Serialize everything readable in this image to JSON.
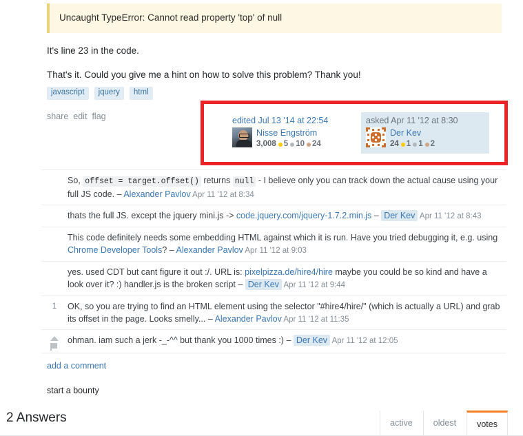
{
  "post": {
    "error_quote": "Uncaught TypeError: Cannot read property 'top' of null",
    "paragraph_1": "It's line 23 in the code.",
    "paragraph_2": "That's it. Could you give me a hint on how to solve this problem? Thank you!"
  },
  "tags": [
    "javascript",
    "jquery",
    "html"
  ],
  "post_menu": [
    "share",
    "edit",
    "flag"
  ],
  "user_cards": [
    {
      "action": "edited Jul 13 '14 at 22:54",
      "name": "Nisse Engström",
      "reputation": "3,008",
      "gold": "5",
      "silver": "10",
      "bronze": "24",
      "avatar_kind": "photo",
      "owner": false
    },
    {
      "action": "asked Apr 11 '12 at 8:30",
      "name": "Der Kev",
      "reputation": "24",
      "gold": "1",
      "silver": "1",
      "bronze": "2",
      "avatar_kind": "identicon",
      "owner": true
    }
  ],
  "comments": [
    {
      "score": "",
      "has_vote_controls": false,
      "parts": [
        {
          "t": "text",
          "v": "So, "
        },
        {
          "t": "code",
          "v": "offset = target.offset()"
        },
        {
          "t": "text",
          "v": " returns "
        },
        {
          "t": "code",
          "v": "null"
        },
        {
          "t": "text",
          "v": " - I believe only you can track down the actual cause using your full JS code. "
        },
        {
          "t": "dash",
          "v": "– "
        },
        {
          "t": "user",
          "v": "Alexander Pavlov"
        },
        {
          "t": "date",
          "v": " Apr 11 '12 at 8:34"
        }
      ]
    },
    {
      "score": "",
      "has_vote_controls": false,
      "parts": [
        {
          "t": "text",
          "v": "thats the full JS. except the jquery mini.js -> "
        },
        {
          "t": "link",
          "v": "code.jquery.com/jquery-1.7.2.min.js"
        },
        {
          "t": "dash",
          "v": " – "
        },
        {
          "t": "owner",
          "v": "Der Kev"
        },
        {
          "t": "date",
          "v": " Apr 11 '12 at 8:43"
        }
      ]
    },
    {
      "score": "",
      "has_vote_controls": false,
      "parts": [
        {
          "t": "text",
          "v": "This code definitely needs some embedding HTML against which it is run. Have you tried debugging it, e.g. using "
        },
        {
          "t": "link",
          "v": "Chrome Developer Tools"
        },
        {
          "t": "text",
          "v": "? "
        },
        {
          "t": "dash",
          "v": "– "
        },
        {
          "t": "user",
          "v": "Alexander Pavlov"
        },
        {
          "t": "date",
          "v": " Apr 11 '12 at 9:03"
        }
      ]
    },
    {
      "score": "",
      "has_vote_controls": false,
      "parts": [
        {
          "t": "text",
          "v": "yes. used CDT but cant figure it out :/. URL is: "
        },
        {
          "t": "link",
          "v": "pixelpizza.de/hire4/hire"
        },
        {
          "t": "text",
          "v": " maybe you could be so kind and have a look over it? :) handler.js is the broken script "
        },
        {
          "t": "dash",
          "v": "– "
        },
        {
          "t": "owner",
          "v": "Der Kev"
        },
        {
          "t": "date",
          "v": " Apr 11 '12 at 9:44"
        }
      ]
    },
    {
      "score": "1",
      "has_vote_controls": false,
      "parts": [
        {
          "t": "text",
          "v": "OK, so you are trying to find an HTML element using the selector \"#hire4/hire/\" (which is actually a URL) and grab its offset in the page. Looks smelly... "
        },
        {
          "t": "dash",
          "v": "– "
        },
        {
          "t": "user",
          "v": "Alexander Pavlov"
        },
        {
          "t": "date",
          "v": " Apr 11 '12 at 11:35"
        }
      ]
    },
    {
      "score": "",
      "has_vote_controls": true,
      "parts": [
        {
          "t": "text",
          "v": "ohman. iam such a jerk -_-^^ but thank you 1000 times :) "
        },
        {
          "t": "dash",
          "v": "– "
        },
        {
          "t": "owner",
          "v": "Der Kev"
        },
        {
          "t": "date",
          "v": " Apr 11 '12 at 12:05"
        }
      ]
    }
  ],
  "add_comment_label": "add a comment",
  "start_bounty_label": "start a bounty",
  "answers": {
    "title": "2 Answers",
    "sort_tabs": [
      {
        "label": "active",
        "selected": false
      },
      {
        "label": "oldest",
        "selected": false
      },
      {
        "label": "votes",
        "selected": true
      }
    ]
  },
  "colors": {
    "accent_orange": "#f48024",
    "link_blue": "#3b77b0",
    "highlight_red": "#ec2227",
    "owner_bg": "#dde9f1",
    "quote_bg": "#fdf7e3",
    "tag_bg": "#e1ecf4"
  }
}
